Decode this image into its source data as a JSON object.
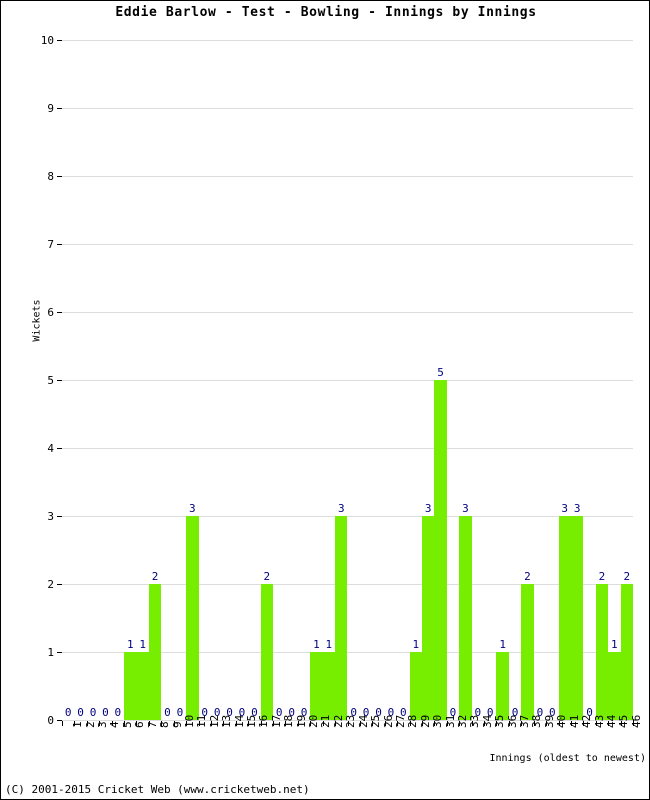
{
  "chart_data": {
    "type": "bar",
    "title": "Eddie Barlow - Test - Bowling - Innings by Innings",
    "xlabel": "Innings (oldest to newest)",
    "ylabel": "Wickets",
    "ylim": [
      0,
      10
    ],
    "ytick_labels": [
      "0",
      "1",
      "2",
      "3",
      "4",
      "5",
      "6",
      "7",
      "8",
      "9",
      "10"
    ],
    "grid": true,
    "legend": false,
    "bar_color": "#77ee00",
    "value_label_color": "#000080",
    "gridline_color": "#dddddd",
    "categories": [
      "1",
      "2",
      "3",
      "4",
      "5",
      "6",
      "7",
      "8",
      "9",
      "10",
      "11",
      "12",
      "13",
      "14",
      "15",
      "16",
      "17",
      "18",
      "19",
      "20",
      "21",
      "22",
      "23",
      "24",
      "25",
      "26",
      "27",
      "28",
      "29",
      "30",
      "31",
      "32",
      "33",
      "34",
      "35",
      "36",
      "37",
      "38",
      "39",
      "40",
      "41",
      "42",
      "43",
      "44",
      "45",
      "46"
    ],
    "values": [
      0,
      0,
      0,
      0,
      0,
      1,
      1,
      2,
      0,
      0,
      3,
      0,
      0,
      0,
      0,
      0,
      2,
      0,
      0,
      0,
      1,
      1,
      3,
      0,
      0,
      0,
      0,
      0,
      1,
      3,
      5,
      0,
      3,
      0,
      0,
      1,
      0,
      2,
      0,
      0,
      3,
      3,
      0,
      2,
      1,
      2
    ]
  },
  "footer": {
    "copyright": "(C) 2001-2015 Cricket Web (www.cricketweb.net)"
  }
}
